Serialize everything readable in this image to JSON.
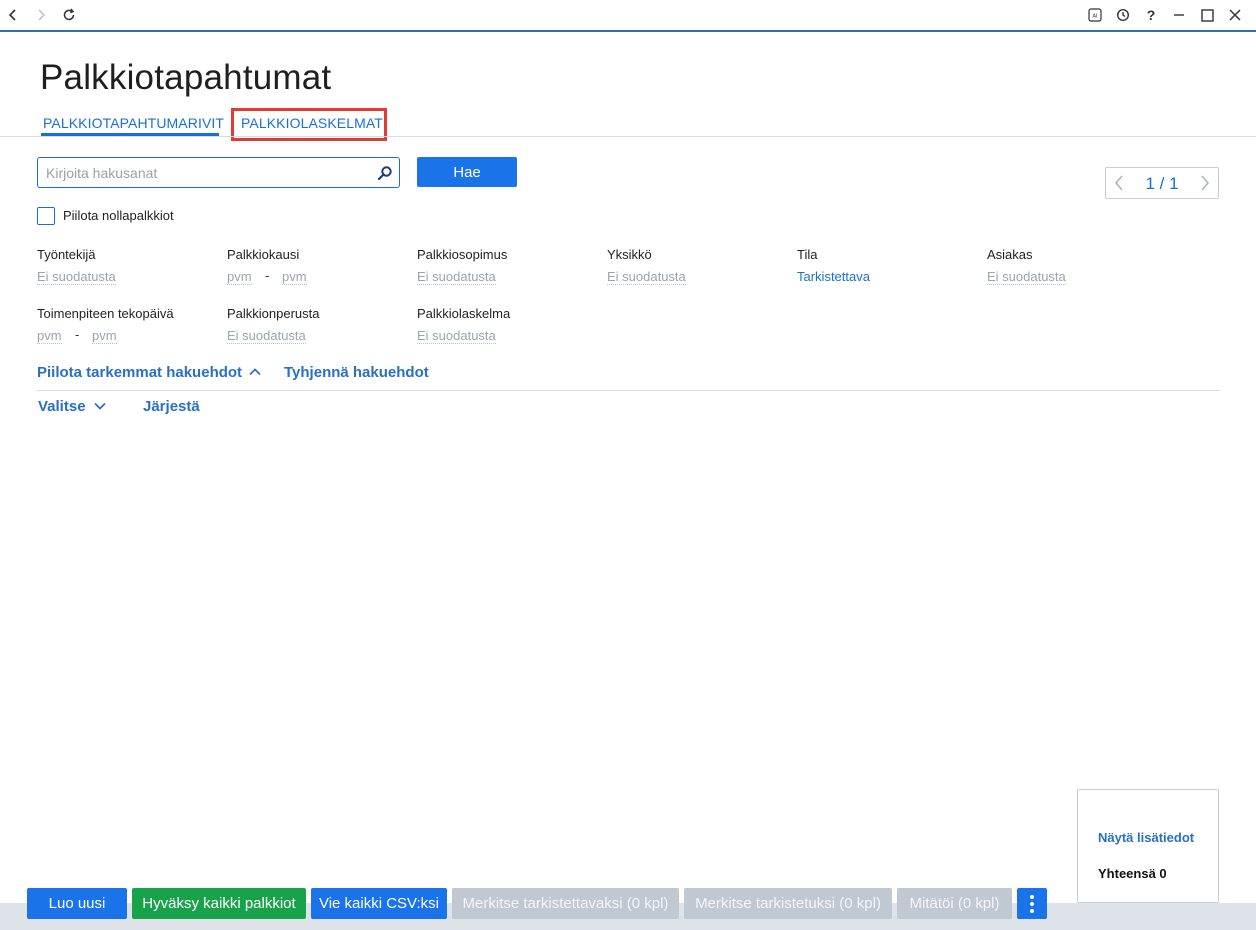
{
  "page": {
    "title": "Palkkiotapahtumat"
  },
  "tabs": [
    {
      "label": "PALKKIOTAPAHTUMARIVIT"
    },
    {
      "label": "PALKKIOLASKELMAT"
    }
  ],
  "search": {
    "placeholder": "Kirjoita hakusanat",
    "button_label": "Hae"
  },
  "pager": {
    "label": "1 / 1"
  },
  "hide_zero": {
    "label": "Piilota nollapalkkiot",
    "checked": false
  },
  "filters": {
    "tyontekija": {
      "label": "Työntekijä",
      "value": "Ei suodatusta"
    },
    "palkkiokausi": {
      "label": "Palkkiokausi",
      "from": "pvm",
      "to": "pvm",
      "dash": "-"
    },
    "palkkiosopimus": {
      "label": "Palkkiosopimus",
      "value": "Ei suodatusta"
    },
    "yksikko": {
      "label": "Yksikkö",
      "value": "Ei suodatusta"
    },
    "tila": {
      "label": "Tila",
      "value": "Tarkistettava"
    },
    "asiakas": {
      "label": "Asiakas",
      "value": "Ei suodatusta"
    },
    "tekopaiva": {
      "label": "Toimenpiteen tekopäivä",
      "from": "pvm",
      "to": "pvm",
      "dash": "-"
    },
    "palkkionperusta": {
      "label": "Palkkionperusta",
      "value": "Ei suodatusta"
    },
    "palkkiolaskelma": {
      "label": "Palkkiolaskelma",
      "value": "Ei suodatusta"
    }
  },
  "search_toggles": {
    "hide_advanced": "Piilota tarkemmat hakuehdot",
    "clear": "Tyhjennä hakuehdot"
  },
  "list_actions": {
    "select": "Valitse",
    "sort": "Järjestä"
  },
  "info_box": {
    "show_details": "Näytä lisätiedot",
    "total": "Yhteensä 0"
  },
  "bottom_actions": {
    "create_new": "Luo uusi",
    "approve_all": "Hyväksy kaikki palkkiot",
    "export_csv": "Vie kaikki CSV:ksi",
    "mark_to_check": "Merkitse tarkistettavaksi (0 kpl)",
    "mark_checked": "Merkitse tarkistetuksi (0 kpl)",
    "cancel": "Mitätöi (0 kpl)"
  },
  "colors": {
    "accent": "#1a73e8",
    "approve": "#18a34a",
    "disabled": "#c0c8d2",
    "highlight": "#e53935"
  }
}
